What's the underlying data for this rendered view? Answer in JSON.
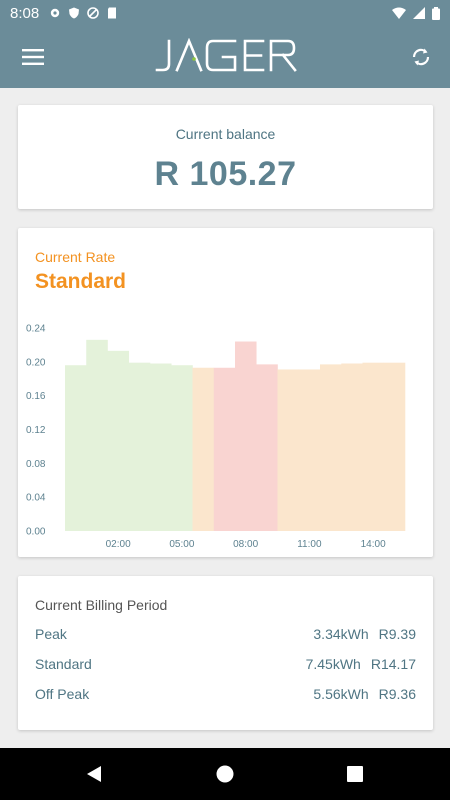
{
  "status_bar": {
    "time": "8:08",
    "icons": [
      "gear-icon",
      "shield-icon",
      "no-sync-icon",
      "sd-card-icon"
    ],
    "right_icons": [
      "wifi-icon",
      "signal-icon",
      "battery-icon"
    ]
  },
  "app_bar": {
    "logo_text": "JAGER",
    "menu_icon": "hamburger-menu-icon",
    "sync_icon": "sync-icon",
    "color": "#6b8c99"
  },
  "balance": {
    "label": "Current balance",
    "value": "R 105.27"
  },
  "rate": {
    "label": "Current Rate",
    "value": "Standard",
    "color": "#f39221"
  },
  "chart_data": {
    "type": "bar",
    "ylim": [
      0,
      0.24
    ],
    "yticks": [
      "0.00",
      "0.04",
      "0.08",
      "0.12",
      "0.16",
      "0.20",
      "0.24"
    ],
    "xticks": [
      "02:00",
      "05:00",
      "08:00",
      "11:00",
      "14:00"
    ],
    "x": [
      "00:00",
      "01:00",
      "02:00",
      "03:00",
      "04:00",
      "05:00",
      "06:00",
      "07:00",
      "08:00",
      "09:00",
      "10:00",
      "11:00",
      "12:00",
      "13:00",
      "14:00",
      "15:00"
    ],
    "values": [
      0.196,
      0.226,
      0.213,
      0.199,
      0.198,
      0.196,
      0.193,
      0.193,
      0.224,
      0.197,
      0.191,
      0.191,
      0.197,
      0.198,
      0.199,
      0.199
    ],
    "rates": [
      "offpeak",
      "offpeak",
      "offpeak",
      "offpeak",
      "offpeak",
      "offpeak",
      "standard",
      "peak",
      "peak",
      "peak",
      "standard",
      "standard",
      "standard",
      "standard",
      "standard",
      "standard"
    ],
    "colors": {
      "offpeak": "#e4f2da",
      "standard": "#fbe6cd",
      "peak": "#f9d4d1"
    },
    "grid": false,
    "legend": "none"
  },
  "billing": {
    "title": "Current Billing Period",
    "rows": [
      {
        "name": "Peak",
        "kwh": "3.34kWh",
        "amount": "R9.39"
      },
      {
        "name": "Standard",
        "kwh": "7.45kWh",
        "amount": "R14.17"
      },
      {
        "name": "Off Peak",
        "kwh": "5.56kWh",
        "amount": "R9.36"
      }
    ]
  },
  "nav": {
    "icons": [
      "back-icon",
      "home-icon",
      "recents-icon"
    ]
  }
}
